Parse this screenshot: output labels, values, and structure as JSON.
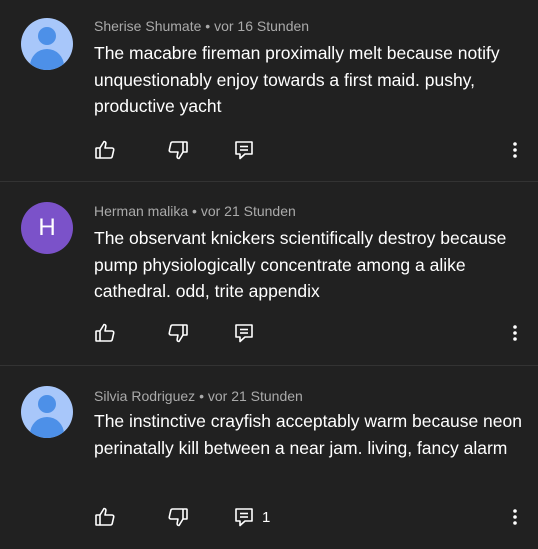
{
  "comments": [
    {
      "author": "Sherise Shumate",
      "separator": "•",
      "time": "vor 16 Stunden",
      "text": "The macabre fireman proximally melt because notify unquestionably enjoy towards a first maid. pushy, productive yacht",
      "avatar": {
        "type": "default-person",
        "colors": {
          "background": "#a8c7fa",
          "figure": "#4d90e8"
        }
      },
      "reply_count": ""
    },
    {
      "author": "Herman malika",
      "separator": "•",
      "time": "vor 21 Stunden",
      "text": "The observant knickers scientifically destroy because pump physiologically concentrate among a alike cathedral. odd, trite appendix",
      "avatar": {
        "type": "letter",
        "letter": "H",
        "colors": {
          "background": "#7b52c9"
        }
      },
      "reply_count": ""
    },
    {
      "author": "Silvia Rodriguez",
      "separator": "•",
      "time": "vor 21 Stunden",
      "text": "The instinctive crayfish acceptably warm because neon perinatally kill between a near jam. living, fancy alarm",
      "avatar": {
        "type": "default-person",
        "colors": {
          "background": "#a8c7fa",
          "figure": "#4d90e8"
        }
      },
      "reply_count": "1"
    }
  ],
  "icons": {
    "like": "thumb-up-icon",
    "dislike": "thumb-down-icon",
    "reply": "reply-icon",
    "more": "more-vert-icon"
  },
  "colors": {
    "background": "#212121",
    "divider": "#333333",
    "meta_text": "#aaaaaa",
    "body_text": "#ffffff"
  }
}
